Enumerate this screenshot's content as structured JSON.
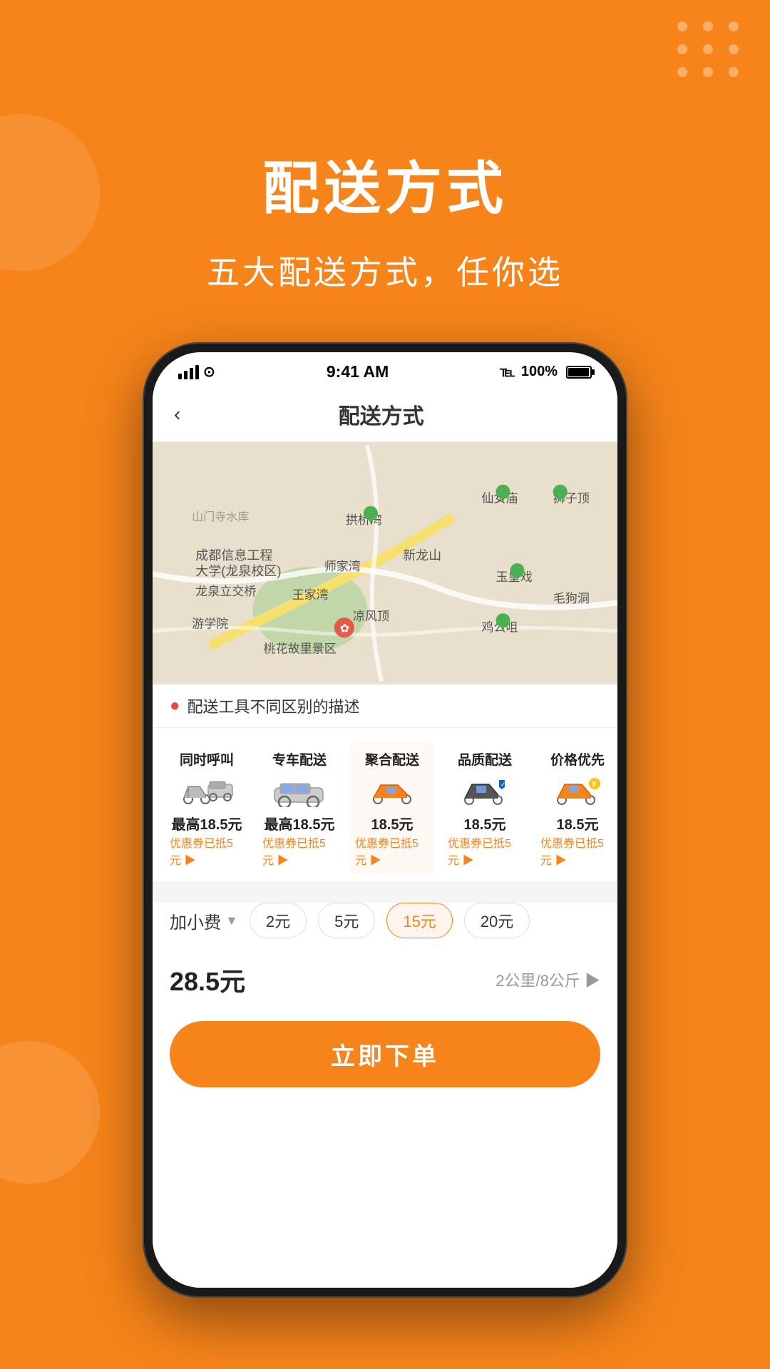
{
  "page": {
    "bg_color": "#F7841A",
    "title": "配送方式",
    "subtitle": "五大配送方式，任你选"
  },
  "status_bar": {
    "time": "9:41 AM",
    "battery_pct": "100%"
  },
  "nav": {
    "back_icon": "‹",
    "title": "配送方式"
  },
  "warning": {
    "icon": "●",
    "text": "配送工具不同区别的描述"
  },
  "delivery_options": [
    {
      "name": "同时呼叫",
      "price": "最高18.5元",
      "coupon": "优惠券已抵5元 ▶",
      "active": false
    },
    {
      "name": "专车配送",
      "price": "最高18.5元",
      "coupon": "优惠券已抵5元 ▶",
      "active": false
    },
    {
      "name": "聚合配送",
      "price": "18.5元",
      "coupon": "优惠券已抵5元 ▶",
      "active": true
    },
    {
      "name": "品质配送",
      "price": "18.5元",
      "coupon": "优惠券已抵5元 ▶",
      "active": false
    },
    {
      "name": "价格优先",
      "price": "18.5元",
      "coupon": "优惠券已抵5元 ▶",
      "active": false
    }
  ],
  "extra_fee": {
    "label": "加小费",
    "options": [
      "2元",
      "5元",
      "15元",
      "20元"
    ],
    "selected": "15元"
  },
  "total": {
    "price": "28.5元",
    "distance": "2公里/8公斤 ▶"
  },
  "order_btn": {
    "label": "立即下单"
  }
}
